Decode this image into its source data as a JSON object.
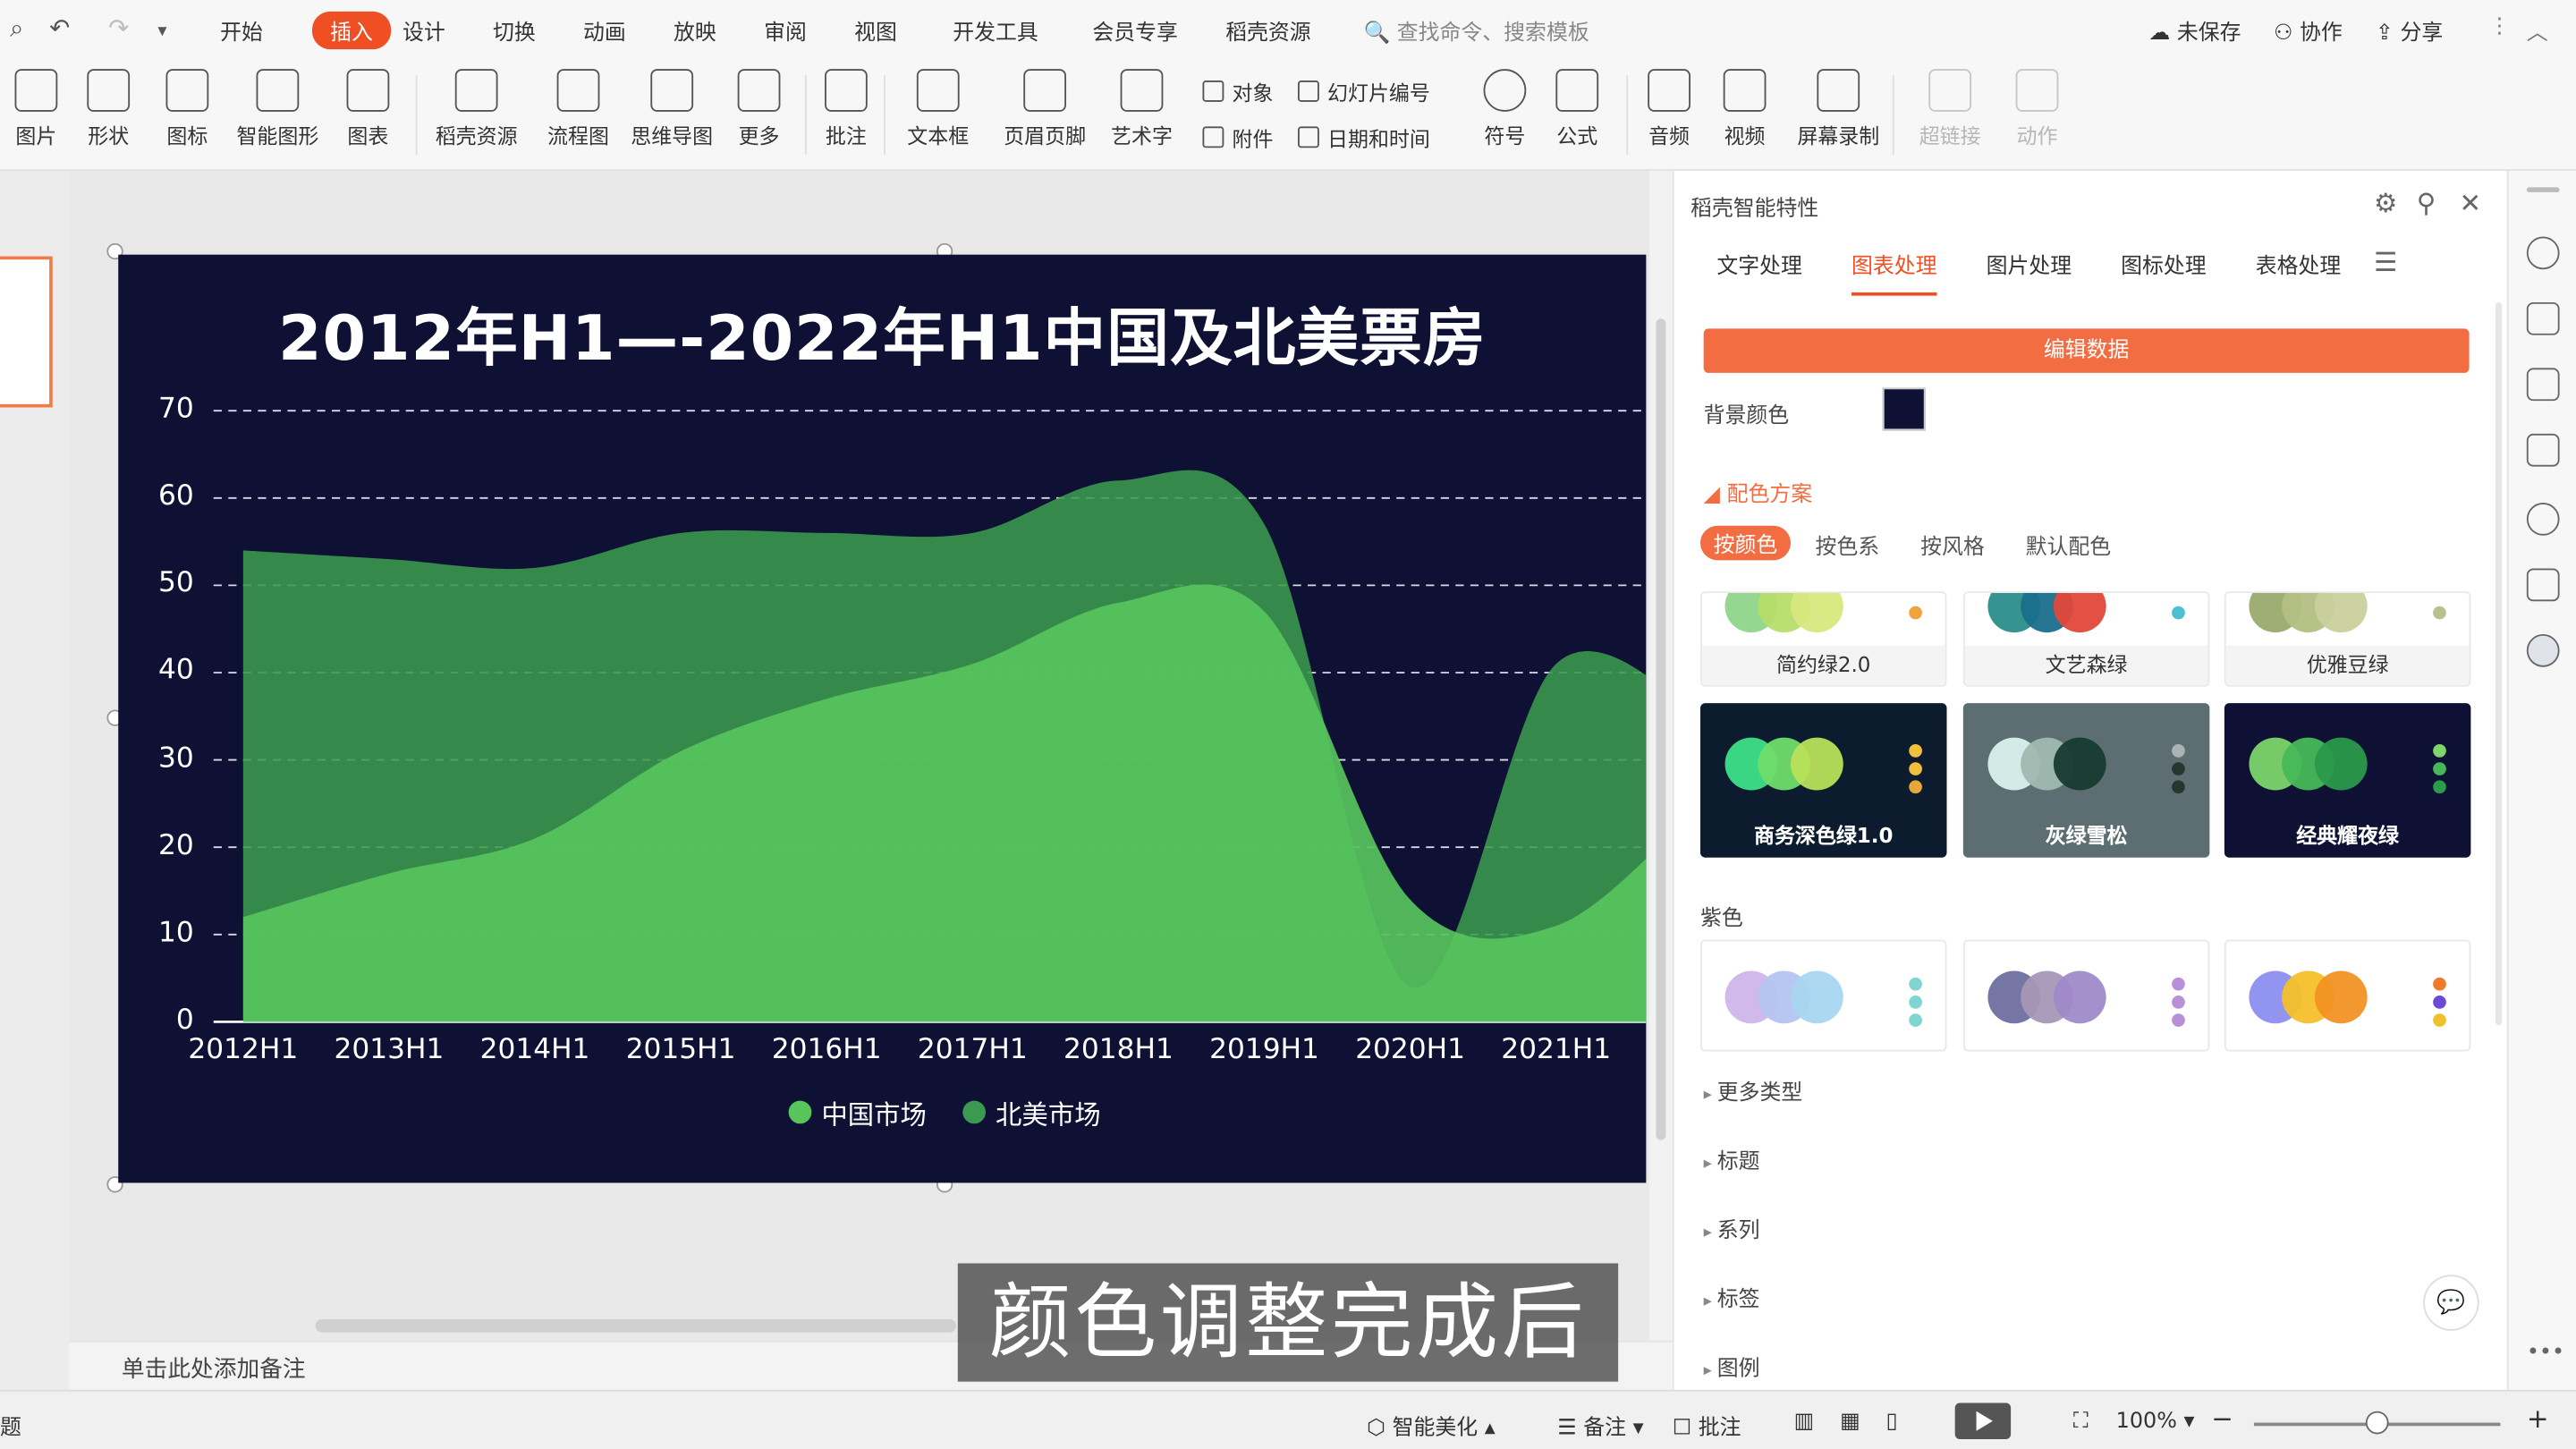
{
  "quick_access": {
    "undo": "↶",
    "redo": "↷",
    "more": "▾"
  },
  "menu": {
    "tabs": [
      "开始",
      "插入",
      "设计",
      "切换",
      "动画",
      "放映",
      "审阅",
      "视图",
      "开发工具",
      "会员专享",
      "稻壳资源"
    ],
    "active": "插入",
    "search_placeholder": "查找命令、搜索模板",
    "unsaved": "未保存",
    "collab": "协作",
    "share": "分享"
  },
  "ribbon": {
    "buttons": [
      "图片",
      "形状",
      "图标",
      "智能图形",
      "图表",
      "稻壳资源",
      "流程图",
      "思维导图",
      "更多",
      "批注",
      "文本框",
      "页眉页脚",
      "艺术字",
      "符号",
      "公式",
      "音频",
      "视频",
      "屏幕录制",
      "超链接",
      "动作"
    ],
    "small": [
      "对象",
      "幻灯片编号",
      "附件",
      "日期和时间"
    ]
  },
  "slide": {
    "background": "#0f1134",
    "note_placeholder": "单击此处添加备注",
    "caption": "颜色调整完成后"
  },
  "chart_data": {
    "type": "area",
    "title": "2012年H1—-2022年H1中国及北美票房",
    "categories": [
      "2012H1",
      "2013H1",
      "2014H1",
      "2015H1",
      "2016H1",
      "2017H1",
      "2018H1",
      "2019H1",
      "2020H1",
      "2021H1"
    ],
    "ylim": [
      0,
      70
    ],
    "yticks": [
      "0",
      "10",
      "20",
      "30",
      "40",
      "50",
      "60",
      "70"
    ],
    "grid": true,
    "legend_position": "bottom",
    "series": [
      {
        "name": "中国市场",
        "color": "#57c45c",
        "values": [
          12,
          17,
          21,
          31,
          37,
          41,
          48,
          47,
          14,
          11,
          25
        ]
      },
      {
        "name": "北美市场",
        "color": "#3b9a4f",
        "values": [
          54,
          53,
          52,
          56,
          56,
          56,
          62,
          57,
          4,
          41,
          35
        ]
      }
    ]
  },
  "panel": {
    "title": "稻壳智能特性",
    "tabs": [
      "文字处理",
      "图表处理",
      "图片处理",
      "图标处理",
      "表格处理"
    ],
    "active_tab": "图表处理",
    "edit_button": "编辑数据",
    "bg_label": "背景颜色",
    "scheme_header": "配色方案",
    "sub_tabs": [
      "按颜色",
      "按色系",
      "按风格",
      "默认配色"
    ],
    "active_sub_tab": "按颜色",
    "schemes_top": [
      {
        "name": "简约绿2.0",
        "colors": [
          "#8fd48a",
          "#b6dd6a",
          "#d7e87d"
        ],
        "dot": "#f0a23c"
      },
      {
        "name": "文艺森绿",
        "colors": [
          "#2a8d8a",
          "#1a6e8c",
          "#e2483a"
        ],
        "dot": "#4cc0d0"
      },
      {
        "name": "优雅豆绿",
        "colors": [
          "#9aaa6e",
          "#b3bf83",
          "#c9d09c"
        ],
        "dot": "#b9c08e"
      }
    ],
    "schemes_green": [
      {
        "name": "商务深色绿1.0",
        "bg": "#0c1b2e",
        "colors": [
          "#3ee088",
          "#6fdc6c",
          "#b8e05a"
        ],
        "dots": [
          "#f0c03c",
          "#f0c03c",
          "#e7a83a"
        ]
      },
      {
        "name": "灰绿雪松",
        "bg": "#5c6e72",
        "colors": [
          "#d9f1ec",
          "#9fb9b0",
          "#163b30"
        ],
        "dots": [
          "#aab3b5",
          "#26362f",
          "#26362f"
        ]
      },
      {
        "name": "经典耀夜绿",
        "bg": "#0f1134",
        "colors": [
          "#7cd66b",
          "#47b85a",
          "#2a9a4b"
        ],
        "dots": [
          "#7cd66b",
          "#47b85a",
          "#2a9a4b"
        ]
      }
    ],
    "purple_header": "紫色",
    "schemes_purple": [
      {
        "colors": [
          "#cfb5ea",
          "#b4c4f0",
          "#a9d6f0"
        ],
        "dots": [
          "#7fd6d0",
          "#7fd6d0",
          "#7fd6d0"
        ]
      },
      {
        "colors": [
          "#6e6f9e",
          "#a797b8",
          "#9f8ac8"
        ],
        "dots": [
          "#b990d8",
          "#b990d8",
          "#b990d8"
        ]
      },
      {
        "colors": [
          "#8b8ff0",
          "#f4c02a",
          "#f29223"
        ],
        "dots": [
          "#f07a2c",
          "#6a4bd8",
          "#f0c02c"
        ]
      }
    ],
    "collapsed": [
      "更多类型",
      "标题",
      "系列",
      "标签",
      "图例"
    ]
  },
  "statusbar": {
    "left": "题",
    "smart_beautify": "智能美化",
    "notes": "备注",
    "comment": "批注",
    "zoom": "100%"
  }
}
